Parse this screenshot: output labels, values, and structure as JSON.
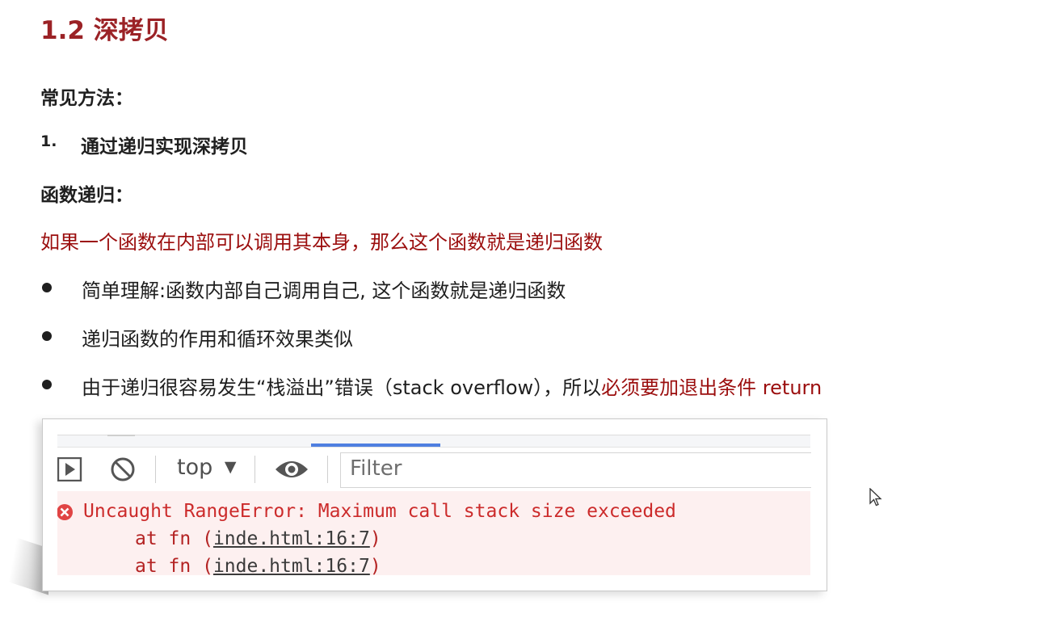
{
  "title": "1.2 深拷贝",
  "methods_heading": "常见方法：",
  "method_1_number": "1.",
  "method_1": "通过递归实现深拷贝",
  "recursion_heading": "函数递归：",
  "definition": "如果一个函数在内部可以调用其本身，那么这个函数就是递归函数",
  "bullets": [
    {
      "text": "简单理解:函数内部自己调用自己, 这个函数就是递归函数",
      "highlight": ""
    },
    {
      "text": "递归函数的作用和循环效果类似",
      "highlight": ""
    },
    {
      "text": "由于递归很容易发生“栈溢出”错误（stack overflow），所以",
      "highlight": "必须要加退出条件 return"
    }
  ],
  "devtools": {
    "context_selector": "top",
    "context_arrow": "▼",
    "filter_placeholder": "Filter",
    "error_message": "Uncaught RangeError: Maximum call stack size exceeded",
    "stack": [
      {
        "prefix": "at fn (",
        "link": "inde.html:16:7",
        "suffix": ")"
      },
      {
        "prefix": "at fn (",
        "link": "inde.html:16:7",
        "suffix": ")"
      }
    ]
  },
  "colors": {
    "title": "#9b2226",
    "definition": "#9b0e0e",
    "error_text": "#cc2b2b",
    "error_bg": "#fdf0f0",
    "active_tab": "#4f7fe0"
  },
  "icons": [
    "play-panel-icon",
    "clear-console-icon",
    "dropdown-arrow-icon",
    "eye-icon",
    "error-icon",
    "mouse-cursor-icon"
  ]
}
